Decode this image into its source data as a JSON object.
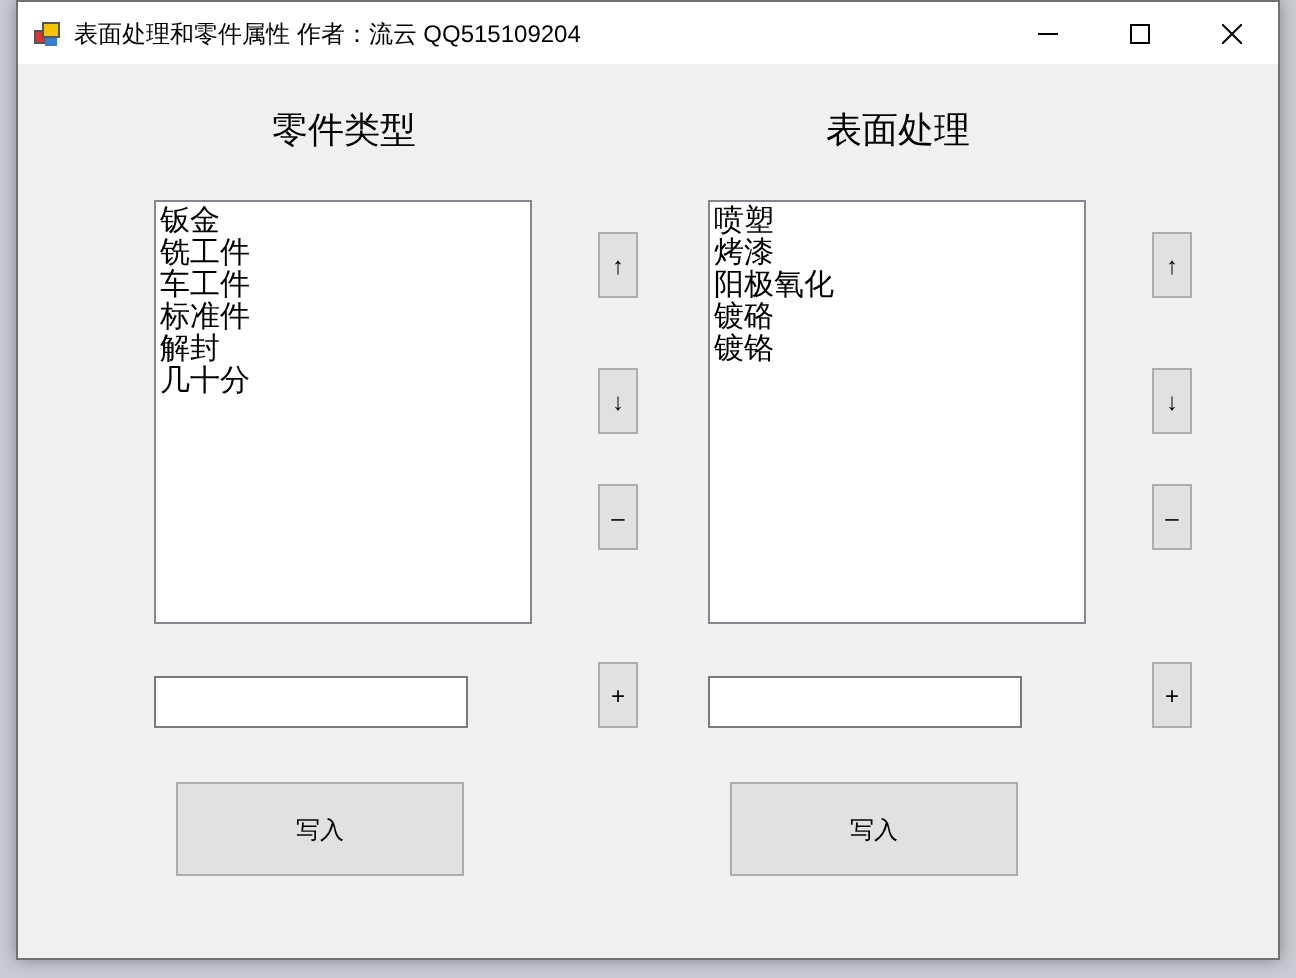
{
  "window": {
    "title": "表面处理和零件属性 作者：流云 QQ515109204"
  },
  "panels": [
    {
      "heading": "零件类型",
      "items": [
        "钣金",
        "铣工件",
        "车工件",
        "标准件",
        "解封",
        "几十分"
      ],
      "side_buttons": [
        "↑",
        "↓",
        "–",
        "+"
      ],
      "write_button": "写入"
    },
    {
      "heading": "表面处理",
      "items": [
        "喷塑",
        "烤漆",
        "阳极氧化",
        "镀硌",
        "镀铬"
      ],
      "side_buttons": [
        "↑",
        "↓",
        "–",
        "+"
      ],
      "write_button": "写入"
    }
  ]
}
